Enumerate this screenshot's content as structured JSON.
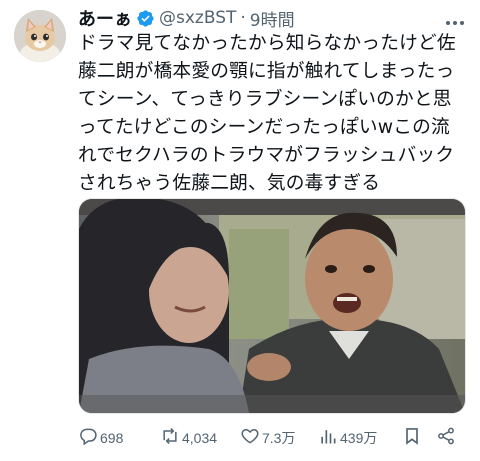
{
  "tweet": {
    "display_name": "あーぁ",
    "handle": "@sxzBST",
    "separator": "·",
    "time": "9時間",
    "text_lines": [
      "ドラマ見てなかったから知らなかったけど佐",
      "藤二朗が橋本愛の顎に指が触れてしまったっ",
      "てシーン、てっきりラブシーンぽいのかと思",
      "ってたけどこのシーンだったっぽいwこの流",
      "れでセクハラのトラウマがフラッシュバック",
      "されちゃう佐藤二朗、気の毒すぎる"
    ],
    "media_alt": "drama still: car scene",
    "actions": {
      "reply_count": "698",
      "retweet_count": "4,034",
      "like_count": "7.3万",
      "view_count": "439万"
    }
  },
  "icons": {
    "verified": "verified-badge-icon",
    "more": "more-icon",
    "reply": "reply-icon",
    "retweet": "retweet-icon",
    "like": "heart-icon",
    "views": "views-chart-icon",
    "bookmark": "bookmark-icon",
    "share": "share-icon"
  },
  "colors": {
    "text": "#0f1419",
    "secondary": "#536471",
    "verified": "#1d9bf0"
  }
}
